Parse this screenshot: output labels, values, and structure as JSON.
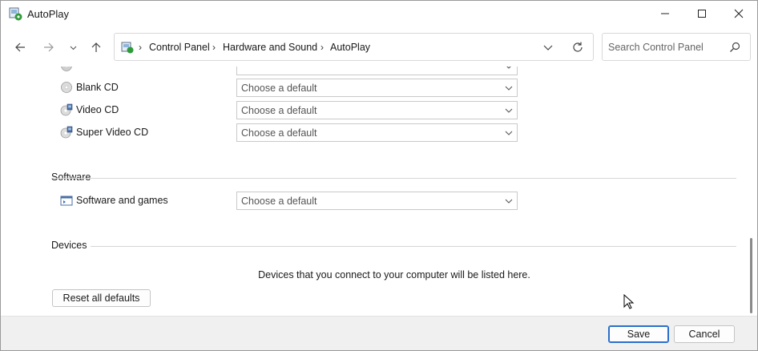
{
  "window": {
    "title": "AutoPlay"
  },
  "nav": {
    "breadcrumbs": [
      "Control Panel",
      "Hardware and Sound",
      "AutoPlay"
    ],
    "search_placeholder": "Search Control Panel"
  },
  "cd_rows": [
    {
      "label": "Blank CD",
      "value": "Choose a default",
      "icon": "blank-cd-icon"
    },
    {
      "label": "Video CD",
      "value": "Choose a default",
      "icon": "video-cd-icon"
    },
    {
      "label": "Super Video CD",
      "value": "Choose a default",
      "icon": "super-video-cd-icon"
    }
  ],
  "software": {
    "title": "Software",
    "rows": [
      {
        "label": "Software and games",
        "value": "Choose a default",
        "icon": "software-icon"
      }
    ]
  },
  "devices": {
    "title": "Devices",
    "message": "Devices that you connect to your computer will be listed here."
  },
  "buttons": {
    "reset": "Reset all defaults",
    "save": "Save",
    "cancel": "Cancel"
  },
  "colors": {
    "accent": "#2a6fc9",
    "footer_bg": "#f0f0f0"
  }
}
